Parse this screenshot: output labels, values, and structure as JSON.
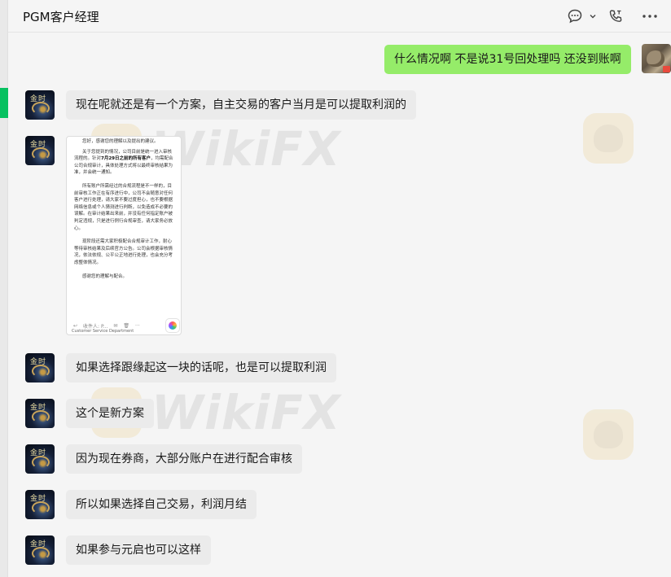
{
  "window": {
    "title": "PGM客户经理"
  },
  "header": {
    "icons": [
      "chat-bubble-icon",
      "chevron-down-icon",
      "phone-icon",
      "more-icon"
    ]
  },
  "messages": {
    "outgoing_1": "什么情况啊 不是说31号回处理吗 还没到账啊",
    "incoming_1": "现在呢就还是有一个方案，自主交易的客户当月是可以提取利润的",
    "incoming_2": "如果选择跟缘起这一块的话呢，也是可以提取利润",
    "incoming_3": "这个是新方案",
    "incoming_4": "因为现在券商，大部分账户在进行配合审核",
    "incoming_5": "所以如果选择自己交易，利润月结",
    "incoming_6": "如果参与元启也可以这样"
  },
  "contact_avatar": {
    "label": "金时"
  },
  "document_image": {
    "p0": "您好，感谢您的理解以及提出的建议。",
    "p1a": "关于您提到的情况，公司目前是统一进入审核流程的。针对",
    "p1b": "7月29日之前的所有客户",
    "p1c": "，均需配合公司合规审计，具体处理方式将以最终审核结果为准，并会统一通知。",
    "p2": "所有账户所需经过的合规流程是不一样的，目前审核工作正在有序进行中，公司不会随意对任何客户进行处理，请大家不要过度担心，也不要根据网络信息或个人猜测进行判断，以免造成不必要的误解。在审计结果出来前，并没有任何指定账户被判定违规，只是进行例行合规审查，请大家务必放心。",
    "p3": "现阶段还需大家积极配合合规审计工作，耐心等待审核结果及后续官方公告。公司会根据审核情况，依法依规、公平公正地进行处理，也会充分考虑整体情况。",
    "p4": "感谢您的理解与配合。",
    "toolbar_reply": "↩",
    "toolbar_label": "收件人: P...",
    "signature": "Customer Service Department"
  },
  "watermark": {
    "text": "WikiFX"
  }
}
